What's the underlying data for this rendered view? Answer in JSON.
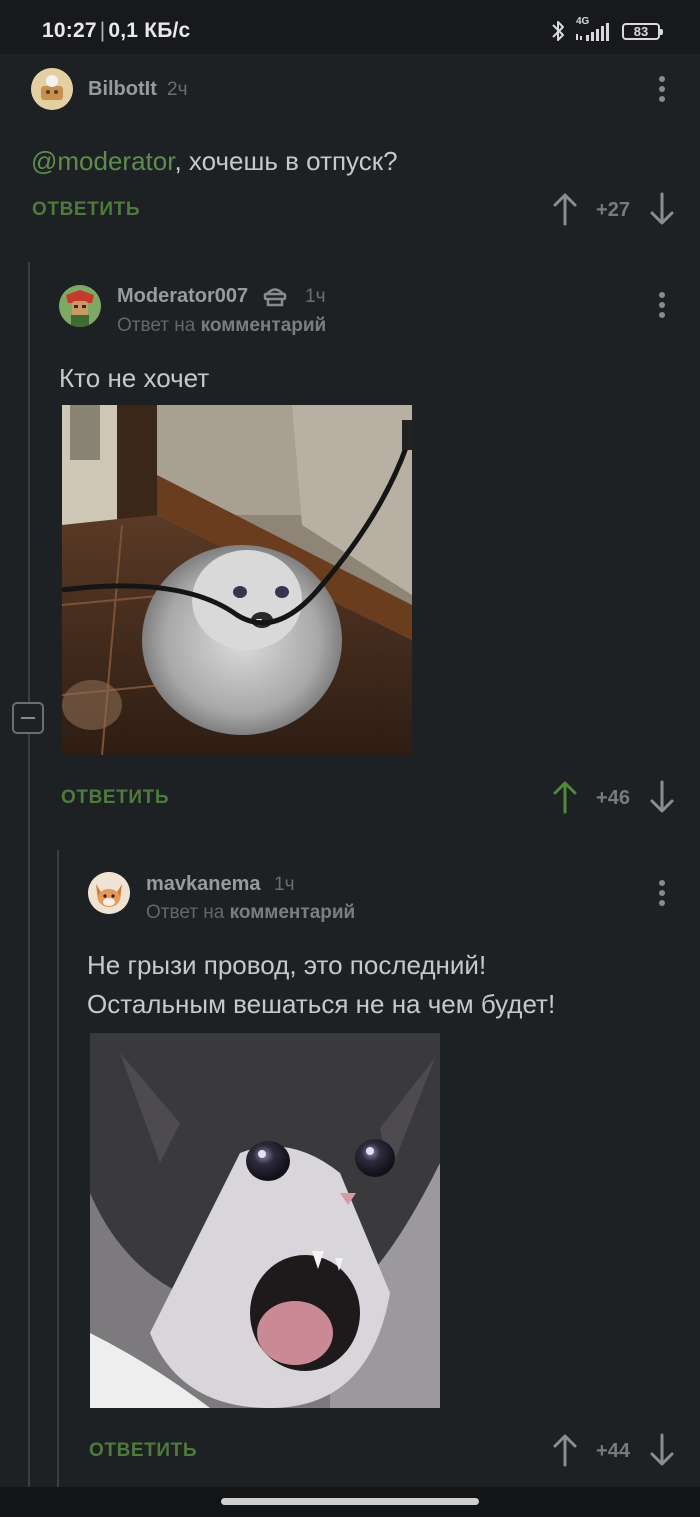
{
  "status_bar": {
    "time": "10:27",
    "separator": "|",
    "speed": "0,1 КБ/с",
    "network": "4G",
    "battery": "83",
    "icons": [
      "bluetooth-icon",
      "signal-icon",
      "battery-icon"
    ]
  },
  "comments": [
    {
      "username": "BilbotIt",
      "time": "2ч",
      "mention": "@moderator",
      "text": ", хочешь в отпуск?",
      "reply_label": "ОТВЕТИТЬ",
      "rating": "+27"
    },
    {
      "username": "Moderator007",
      "badge": "moderator-badge-icon",
      "time": "1ч",
      "reply_prefix": "Ответ на",
      "reply_target": "комментарий",
      "text": "Кто не хочет",
      "image": "fluffy-cat-biting-cable",
      "reply_label": "ОТВЕТИТЬ",
      "rating": "+46"
    },
    {
      "username": "mavkanema",
      "time": "1ч",
      "reply_prefix": "Ответ на",
      "reply_target": "комментарий",
      "text_lines": [
        "Не грызи провод, это последний!",
        "Остальным вешаться не на чем будет!"
      ],
      "image": "crying-cat-meme",
      "reply_label": "ОТВЕТИТЬ",
      "rating": "+44"
    }
  ],
  "colors": {
    "background": "#1e2124",
    "accent_green": "#4e7a3c",
    "mention_green": "#5f8c4c",
    "upvoted_green": "#4d8a3a"
  }
}
